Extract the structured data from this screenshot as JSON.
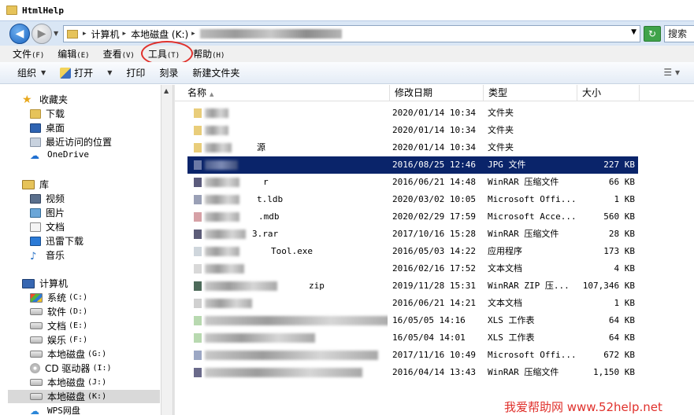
{
  "window": {
    "title": "HtmlHelp"
  },
  "address": {
    "segments": [
      "计算机",
      "本地磁盘 (K:)"
    ],
    "search_label": "搜索"
  },
  "menu": [
    {
      "label": "文件",
      "key": "(F)"
    },
    {
      "label": "编辑",
      "key": "(E)"
    },
    {
      "label": "查看",
      "key": "(V)"
    },
    {
      "label": "工具",
      "key": "(T)"
    },
    {
      "label": "帮助",
      "key": "(H)"
    }
  ],
  "commands": {
    "organize": "组织",
    "open": "打开",
    "print": "打印",
    "burn": "刻录",
    "new_folder": "新建文件夹"
  },
  "nav": {
    "favorites": {
      "label": "收藏夹",
      "items": [
        "下载",
        "桌面",
        "最近访问的位置",
        "OneDrive"
      ]
    },
    "libraries": {
      "label": "库",
      "items": [
        "视频",
        "图片",
        "文档",
        "迅雷下载",
        "音乐"
      ]
    },
    "computer": {
      "label": "计算机",
      "drives": [
        {
          "label": "系统",
          "letter": "(C:)"
        },
        {
          "label": "软件",
          "letter": "(D:)"
        },
        {
          "label": "文档",
          "letter": "(E:)"
        },
        {
          "label": "娱乐",
          "letter": "(F:)"
        },
        {
          "label": "本地磁盘",
          "letter": "(G:)"
        },
        {
          "label": "CD 驱动器",
          "letter": "(I:)"
        },
        {
          "label": "本地磁盘",
          "letter": "(J:)"
        },
        {
          "label": "本地磁盘",
          "letter": "(K:)"
        }
      ],
      "wps": "WPS网盘"
    }
  },
  "columns": {
    "name": "名称",
    "modified": "修改日期",
    "type": "类型",
    "size": "大小"
  },
  "files": [
    {
      "name_suffix": "",
      "modified": "2020/01/14 10:34",
      "type": "文件夹",
      "size": ""
    },
    {
      "name_suffix": "",
      "modified": "2020/01/14 10:34",
      "type": "文件夹",
      "size": ""
    },
    {
      "name_suffix": "源",
      "modified": "2020/01/14 10:34",
      "type": "文件夹",
      "size": ""
    },
    {
      "name_suffix": "",
      "modified": "2016/08/25 12:46",
      "type": "JPG 文件",
      "size": "227 KB"
    },
    {
      "name_suffix": "r",
      "modified": "2016/06/21 14:48",
      "type": "WinRAR 压缩文件",
      "size": "66 KB"
    },
    {
      "name_suffix": "t.ldb",
      "modified": "2020/03/02 10:05",
      "type": "Microsoft Offi...",
      "size": "1 KB"
    },
    {
      "name_suffix": ".mdb",
      "modified": "2020/02/29 17:59",
      "type": "Microsoft Acce...",
      "size": "560 KB"
    },
    {
      "name_suffix": "3.rar",
      "modified": "2017/10/16 15:28",
      "type": "WinRAR 压缩文件",
      "size": "28 KB"
    },
    {
      "name_suffix": "Tool.exe",
      "modified": "2016/05/03 14:22",
      "type": "应用程序",
      "size": "173 KB"
    },
    {
      "name_suffix": "",
      "modified": "2016/02/16 17:52",
      "type": "文本文档",
      "size": "4 KB"
    },
    {
      "name_suffix": "zip",
      "modified": "2019/11/28 15:31",
      "type": "WinRAR ZIP 压...",
      "size": "107,346 KB"
    },
    {
      "name_suffix": "",
      "modified": "2016/06/21 14:21",
      "type": "文本文档",
      "size": "1 KB"
    },
    {
      "name_suffix": "",
      "modified": "16/05/05 14:16",
      "type": "XLS 工作表",
      "size": "64 KB"
    },
    {
      "name_suffix": "",
      "modified": "16/05/04 14:01",
      "type": "XLS 工作表",
      "size": "64 KB"
    },
    {
      "name_suffix": "",
      "modified": "2017/11/16 10:49",
      "type": "Microsoft Offi...",
      "size": "672 KB"
    },
    {
      "name_suffix": "",
      "modified": "2016/04/14 13:43",
      "type": "WinRAR 压缩文件",
      "size": "1,150 KB"
    }
  ],
  "selected_row": 3,
  "watermark": "我爱帮助网 www.52help.net",
  "colors": {
    "selection": "#0a246a",
    "annotation_circle": "#e0312c"
  }
}
